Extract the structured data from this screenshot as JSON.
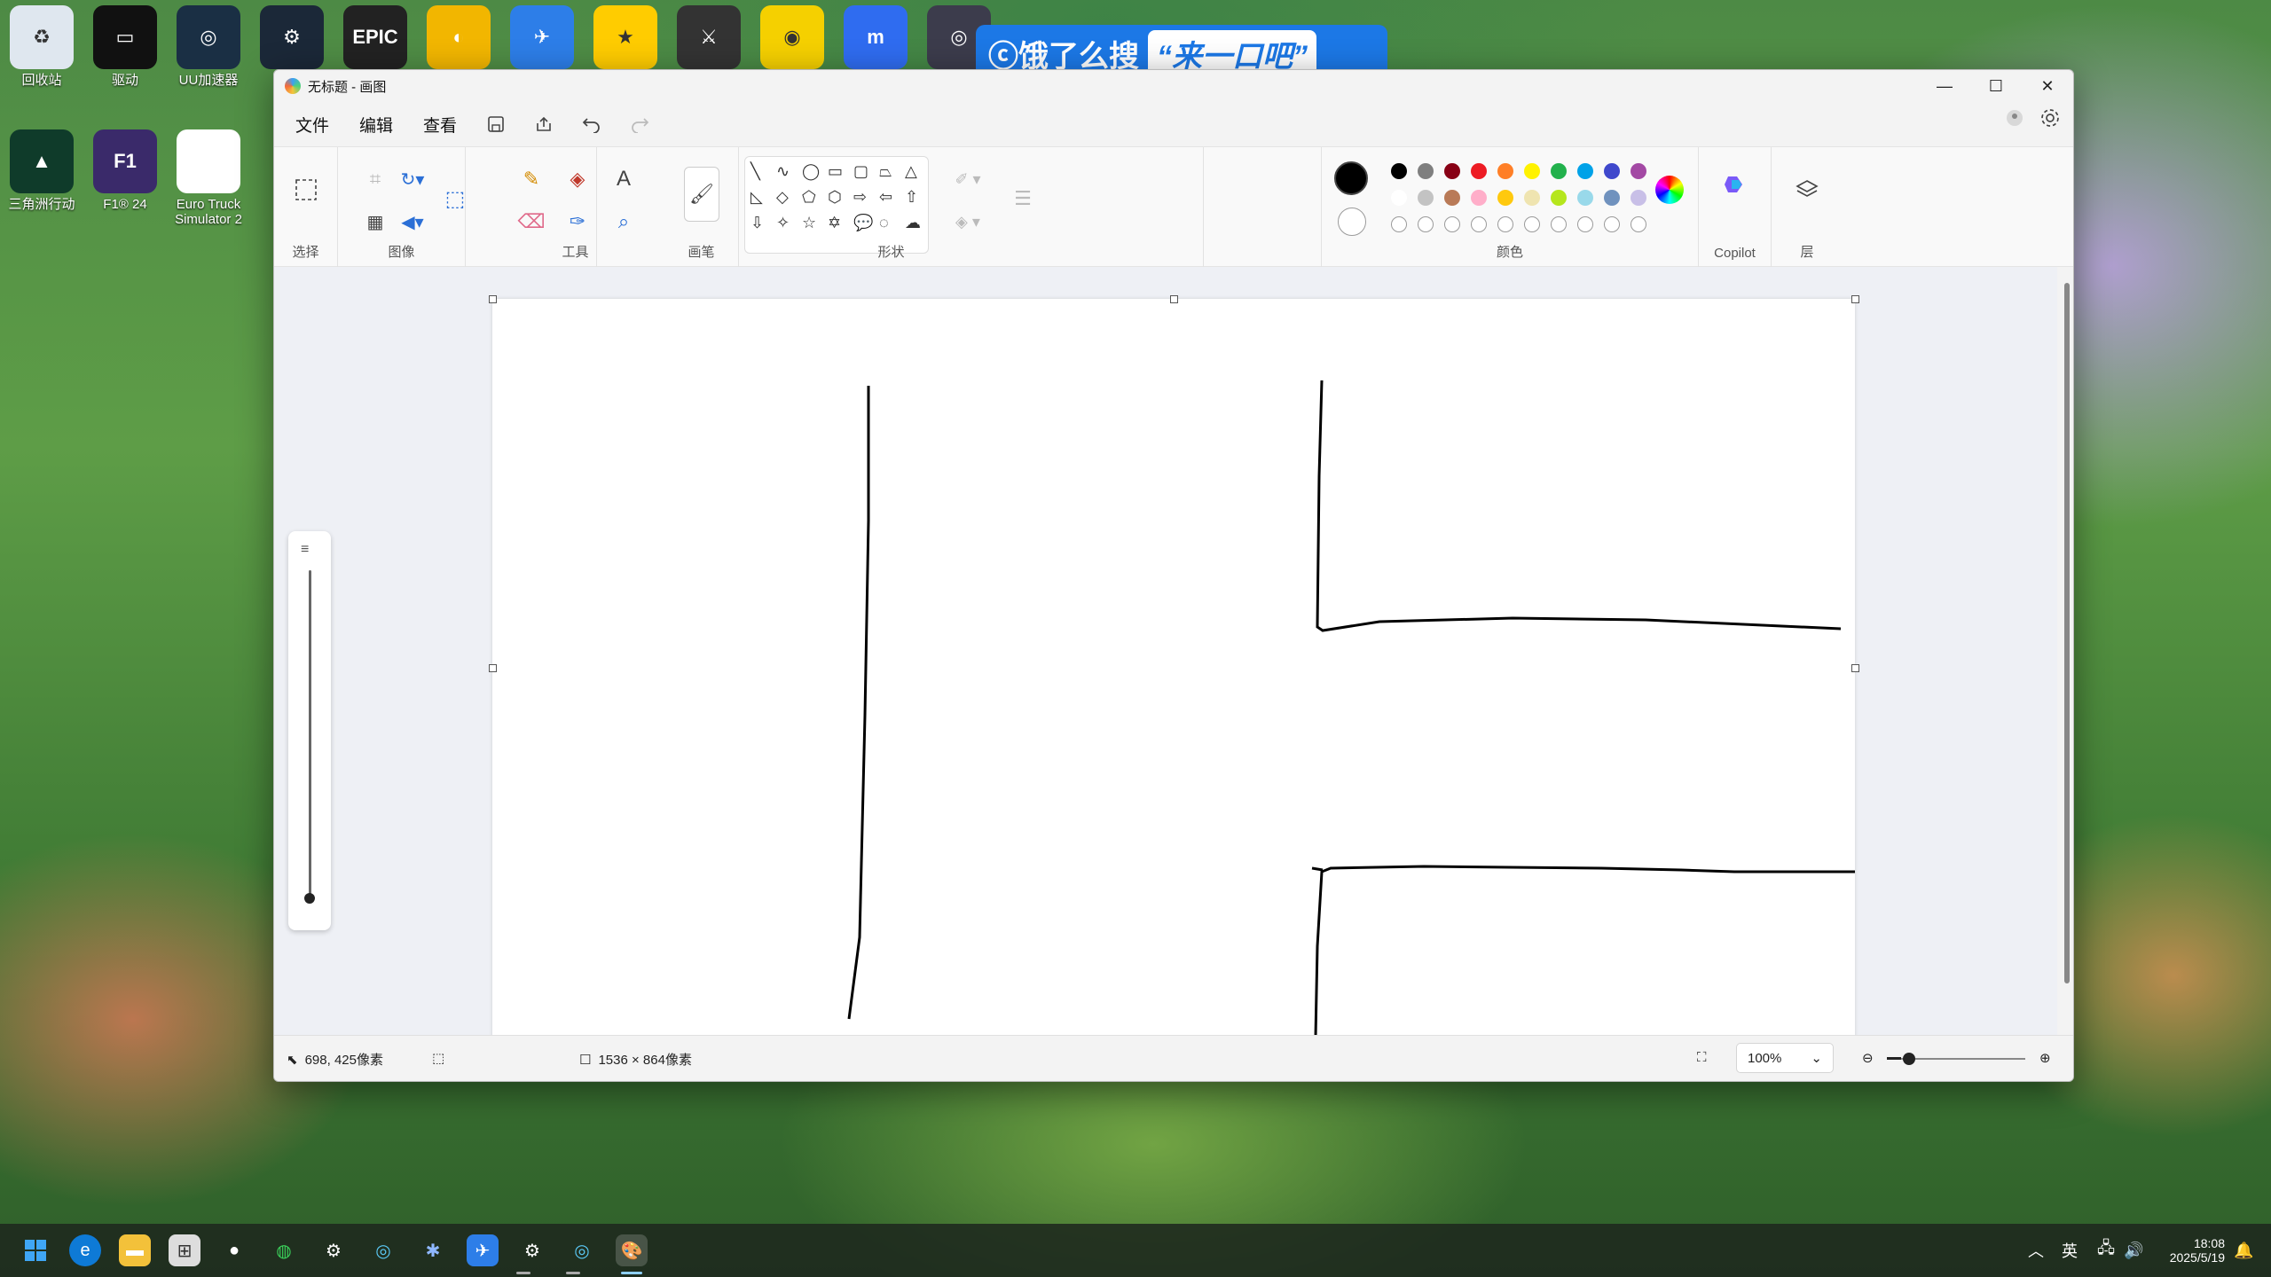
{
  "desktop": {
    "icons_row1": [
      {
        "label": "回收站",
        "color": "#dfe7ef",
        "glyph": "♻"
      },
      {
        "label": "驱动",
        "color": "#111111",
        "glyph": "▭"
      },
      {
        "label": "UU加速器",
        "color": "#1a2f44",
        "glyph": "◎"
      },
      {
        "label": "",
        "color": "#1b2838",
        "glyph": "⚙"
      },
      {
        "label": "",
        "color": "#222222",
        "glyph": "EPIC"
      },
      {
        "label": "",
        "color": "#f2b600",
        "glyph": "◐"
      },
      {
        "label": "",
        "color": "#2d7ee8",
        "glyph": "✈"
      },
      {
        "label": "",
        "color": "#ffcc00",
        "glyph": "★"
      },
      {
        "label": "",
        "color": "#333333",
        "glyph": "⚔"
      },
      {
        "label": "",
        "color": "#f5d000",
        "glyph": "◉"
      },
      {
        "label": "",
        "color": "#2f6cf0",
        "glyph": "m"
      },
      {
        "label": "",
        "color": "#3c3c4c",
        "glyph": "◎"
      }
    ],
    "icons_row2": [
      {
        "label": "三角洲行动",
        "color": "#0f3b2a",
        "glyph": "▲"
      },
      {
        "label": "F1® 24",
        "color": "#3a2a6a",
        "glyph": "F1"
      },
      {
        "label": "Euro Truck Simulator 2",
        "color": "#ffffff",
        "glyph": ""
      }
    ]
  },
  "banner": {
    "prefix": "饿了么搜",
    "quote": "“来一口吧”",
    "color": "#1c78e6"
  },
  "window": {
    "title": "无标题 - 画图",
    "controls": {
      "minimize": "—",
      "maximize": "☐",
      "close": "✕"
    }
  },
  "menubar": {
    "items": [
      "文件",
      "编辑",
      "查看"
    ]
  },
  "ribbon": {
    "groups": {
      "select": "选择",
      "image": "图像",
      "tools": "工具",
      "brush": "画笔",
      "shapes": "形状",
      "colors": "颜色",
      "copilot": "Copilot",
      "layers": "层"
    },
    "current_color": "#000000",
    "palette_row1": [
      "#000000",
      "#7f7f7f",
      "#880015",
      "#ed1c24",
      "#ff7f27",
      "#fff200",
      "#22b14c",
      "#00a2e8",
      "#3f48cc",
      "#a349a4"
    ],
    "palette_row2": [
      "#ffffff",
      "#c3c3c3",
      "#b97a57",
      "#ffaec9",
      "#ffc90e",
      "#efe4b0",
      "#b5e61d",
      "#99d9ea",
      "#7092be",
      "#c8bfe7"
    ]
  },
  "statusbar": {
    "cursor_pos": "698, 425像素",
    "canvas_size": "1536 × 864像素",
    "zoom": "100%"
  },
  "taskbar": {
    "time": "18:08",
    "date": "2025/5/19",
    "lang": "英"
  }
}
